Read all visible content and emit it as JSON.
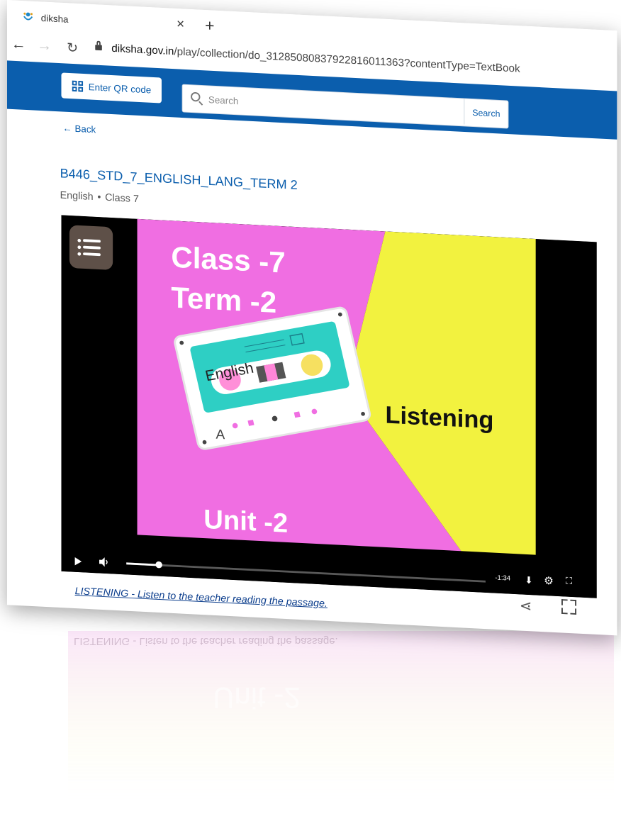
{
  "browser": {
    "tab_title": "diksha",
    "tab_close": "×",
    "new_tab": "+",
    "url_domain": "diksha.gov.in",
    "url_path": "/play/collection/do_312850808379228160113​63?contentType=TextBook"
  },
  "header": {
    "qr_button_label": "Enter QR code",
    "search_placeholder": "Search",
    "search_button_label": "Search",
    "brand_color": "#0b5ead"
  },
  "page": {
    "back_label": "Back",
    "title": "B446_STD_7_ENGLISH_LANG_TERM 2",
    "subject": "English",
    "separator": "•",
    "grade": "Class 7"
  },
  "slide": {
    "line1": "Class -7",
    "line2": "Term -2",
    "cassette_label": "English",
    "cassette_side": "A",
    "topic": "Listening",
    "unit": "Unit -2",
    "colors": {
      "pink": "#f06ee2",
      "yellow": "#f2f23f",
      "teal": "#2ecfc4"
    }
  },
  "player": {
    "time_remaining": "-1:34",
    "progress": 0.09
  },
  "caption": "LISTENING - Listen to the teacher reading the passage."
}
